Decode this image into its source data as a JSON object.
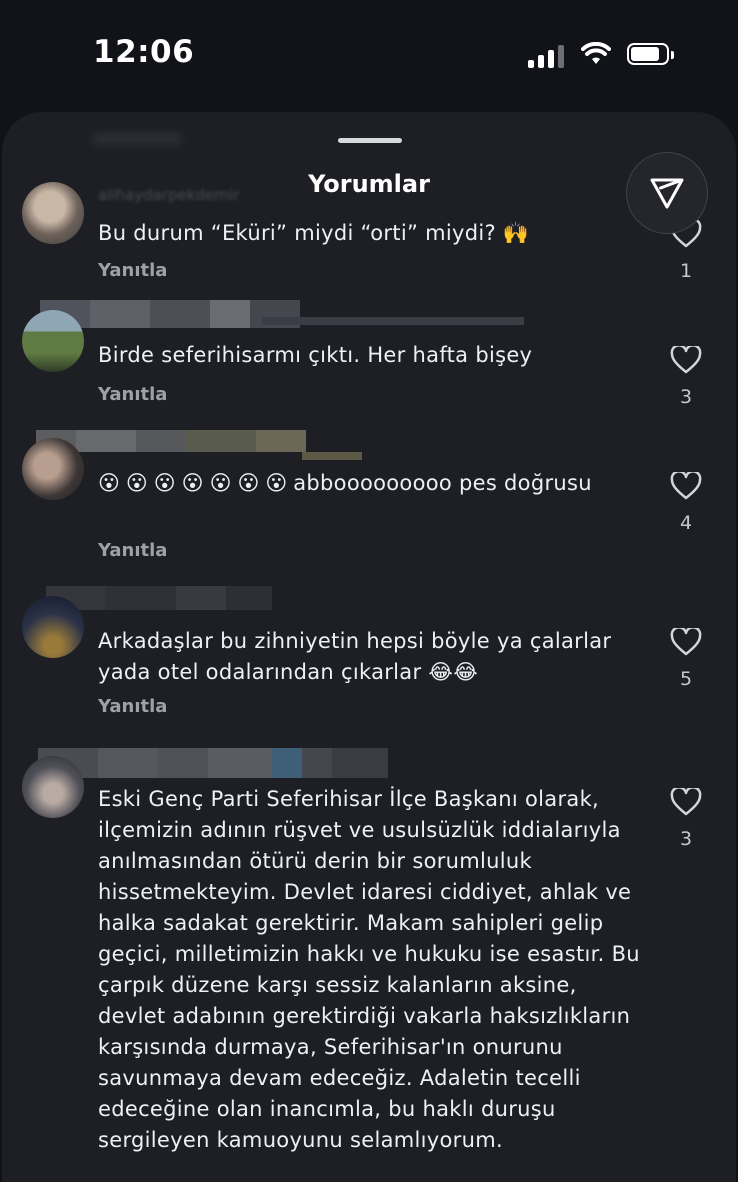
{
  "status": {
    "time": "12:06"
  },
  "sheet": {
    "title": "Yorumlar",
    "share_icon": "send-icon"
  },
  "comments": [
    {
      "username": "alihaydarpekdemir",
      "text": "Bu durum “Eküri” miydi “orti” miydi? 🙌",
      "reply_label": "Yanıtla",
      "likes": "1"
    },
    {
      "username": "",
      "text": "Birde seferihisarmı çıktı. Her hafta bişey",
      "reply_label": "Yanıtla",
      "likes": "3"
    },
    {
      "username": "",
      "text_prefix_emoji": "😮😮😮😮😮😮😮",
      "text": "abbooooooooo pes doğrusu",
      "reply_label": "Yanıtla",
      "likes": "4"
    },
    {
      "username": "",
      "text": "Arkadaşlar bu zihniyetin hepsi böyle ya çalarlar yada otel odalarından çıkarlar 😂😂",
      "reply_label": "Yanıtla",
      "likes": "5"
    },
    {
      "username": "",
      "text": "Eski Genç Parti Seferihisar İlçe Başkanı olarak, ilçemizin adının rüşvet ve usulsüzlük iddialarıyla anılmasından ötürü derin bir sorumluluk hissetmekteyim. Devlet idaresi ciddiyet, ahlak ve halka sadakat gerektirir. Makam sahipleri gelip geçici, milletimizin hakkı ve hukuku ise esastır. Bu çarpık düzene karşı sessiz kalanların aksine, devlet adabının gerektirdiği vakarla haksızlıkların karşısında durmaya, Seferihisar'ın onurunu savunmaya devam edeceğiz. Adaletin tecelli edeceğine olan inancımla, bu haklı duruşu sergileyen kamuoyunu selamlıyorum.",
      "likes": "3"
    }
  ],
  "colors": {
    "background": "#111318",
    "sheet": "#1d1f24",
    "text": "#eef0f4",
    "muted": "#9ea1a8"
  }
}
